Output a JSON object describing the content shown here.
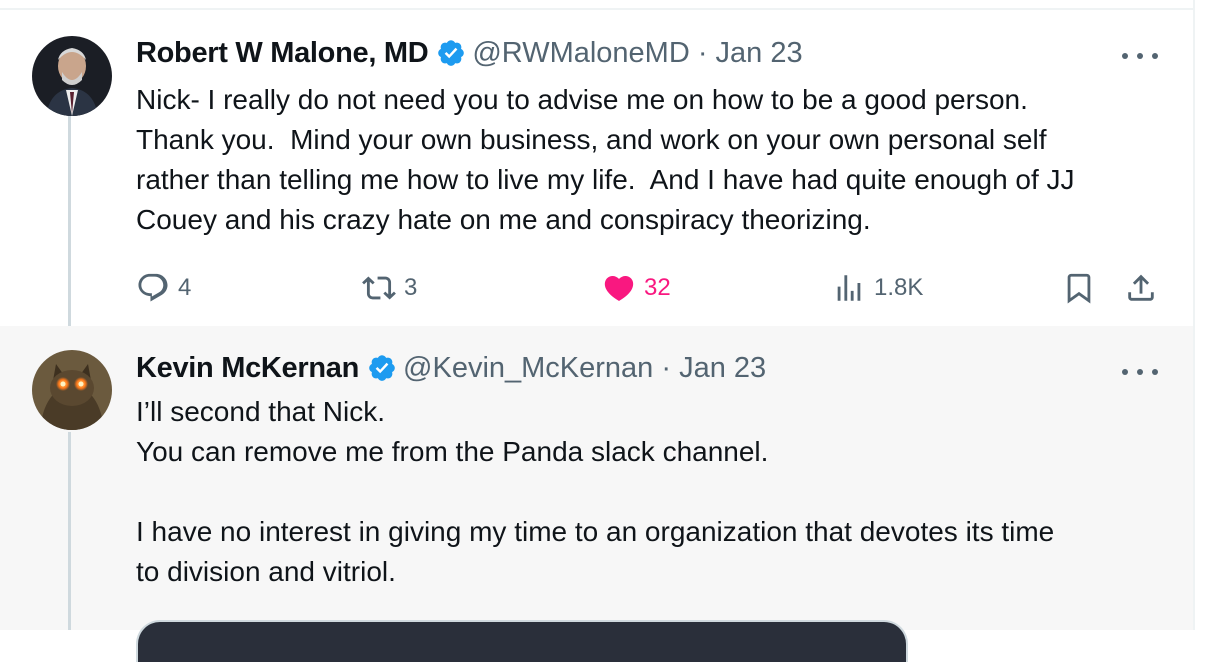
{
  "tweets": [
    {
      "author": "Robert W Malone, MD",
      "handle_date": "@RWMaloneMD · Jan 23",
      "body": "Nick- I really do not need you to advise me on how to be a good person.\nThank you.  Mind your own business, and work on your own personal self\nrather than telling me how to live my life.  And I have had quite enough of JJ\nCouey and his crazy hate on me and conspiracy theorizing.",
      "replies": "4",
      "reposts": "3",
      "likes": "32",
      "views": "1.8K"
    },
    {
      "author": "Kevin McKernan",
      "handle_date": "@Kevin_McKernan · Jan 23",
      "body": "I’ll second that Nick.\nYou can remove me from the Panda slack channel.\n\nI have no interest in giving my time to an organization that devotes its time\nto division and vitriol."
    }
  ],
  "icons": {
    "verified_badge": "verified-badge-icon",
    "more": "more-icon",
    "reply": "reply-icon",
    "repost": "repost-icon",
    "like": "heart-icon",
    "views": "views-icon",
    "bookmark": "bookmark-icon",
    "share": "share-icon"
  },
  "colors": {
    "verified": "#1d9bf0",
    "like": "#f91880",
    "secondary_text": "#536471"
  }
}
